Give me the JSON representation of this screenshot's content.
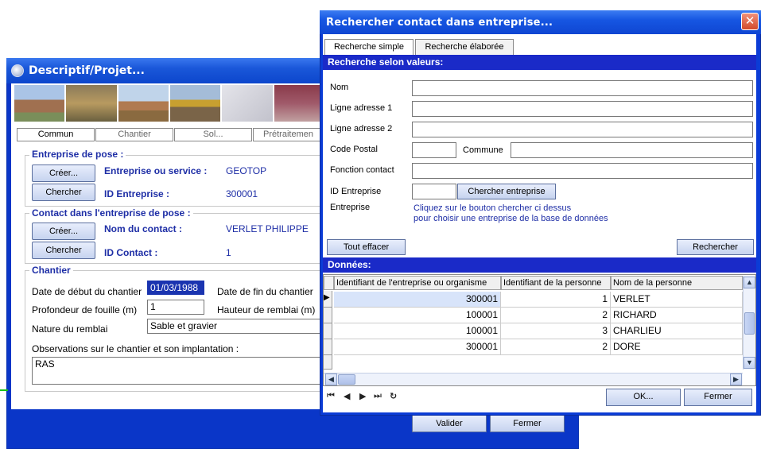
{
  "background_window": {
    "title": "Descriptif/Projet...",
    "tabs": [
      "Commun",
      "Chantier",
      "Sol...",
      "Prétraitemen"
    ],
    "entreprise_group": {
      "title": "Entreprise de pose :",
      "create_label": "Créer...",
      "search_label": "Chercher",
      "service_label": "Entreprise ou service :",
      "service_value": "GEOTOP",
      "id_label": "ID Entreprise :",
      "id_value": "300001"
    },
    "contact_group": {
      "title": "Contact dans l'entreprise de pose :",
      "create_label": "Créer...",
      "search_label": "Chercher",
      "name_label": "Nom du contact :",
      "name_value": "VERLET PHILIPPE",
      "id_label": "ID Contact :",
      "id_value": "1"
    },
    "chantier_group": {
      "title": "Chantier",
      "start_label": "Date de début du chantier",
      "start_value": "01/03/1988",
      "end_label": "Date de fin du chantier",
      "depth_label": "Profondeur de fouille (m)",
      "depth_value": "1",
      "fill_height_label": "Hauteur de remblai (m)",
      "fill_nature_label": "Nature du remblai",
      "fill_nature_value": "Sable et gravier",
      "obs_label": "Observations sur le chantier et son implantation :",
      "obs_value": "RAS"
    },
    "validate_label": "Valider",
    "close_label": "Fermer"
  },
  "dialog": {
    "title": "Rechercher contact dans entreprise...",
    "close_glyph": "✕",
    "tabs": [
      "Recherche simple",
      "Recherche élaborée"
    ],
    "search_section": "Recherche selon valeurs:",
    "fields": {
      "nom": "Nom",
      "adresse1": "Ligne adresse 1",
      "adresse2": "Ligne adresse 2",
      "code_postal": "Code Postal",
      "commune": "Commune",
      "fonction": "Fonction contact",
      "id_entreprise": "ID Entreprise",
      "entreprise": "Entreprise"
    },
    "search_company_button": "Chercher entreprise",
    "hint_line1": "Cliquez sur le bouton chercher ci dessus",
    "hint_line2": "pour choisir une entreprise de la base de données",
    "clear_button": "Tout effacer",
    "search_button": "Rechercher",
    "data_section": "Données:",
    "grid": {
      "columns": [
        "Identifiant de l'entreprise ou organisme",
        "Identifiant de la personne",
        "Nom de la personne"
      ],
      "rows": [
        [
          "300001",
          "1",
          "VERLET"
        ],
        [
          "100001",
          "2",
          "RICHARD"
        ],
        [
          "100001",
          "3",
          "CHARLIEU"
        ],
        [
          "300001",
          "2",
          "DORE"
        ]
      ]
    },
    "ok_button": "OK...",
    "close_button": "Fermer"
  }
}
